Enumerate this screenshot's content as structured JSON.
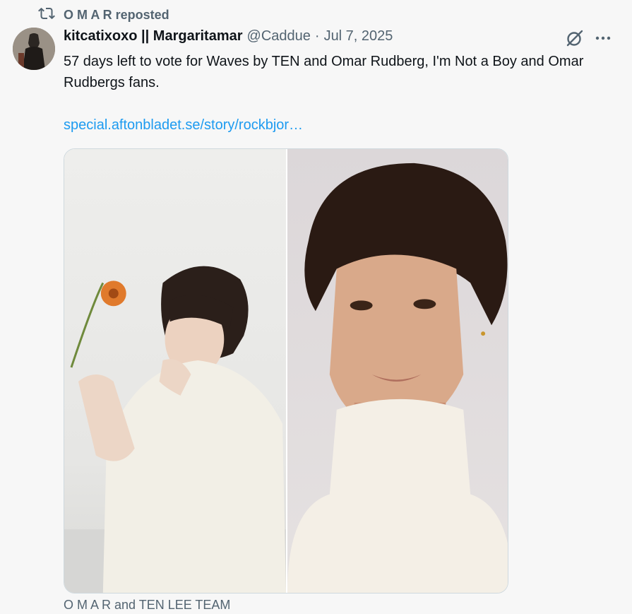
{
  "repost": {
    "label": "O M A R reposted",
    "icon": "repost-icon"
  },
  "author": {
    "display_name": "kitcatixoxo || Margaritamar",
    "handle": "@Caddue",
    "separator": "·",
    "date": "Jul 7, 2025",
    "avatar_icon": "avatar"
  },
  "tweet": {
    "text": "57 days left to vote for Waves by TEN and Omar Rudberg, I'm Not a Boy and Omar Rudbergs fans.",
    "link": "special.aftonbladet.se/story/rockbjor…"
  },
  "actions": {
    "grok_icon": "grok-icon",
    "more_icon": "more-icon"
  },
  "media": {
    "caption": "O M A R and TEN LEE TEAM",
    "photos": [
      "photo-left",
      "photo-right"
    ]
  },
  "colors": {
    "link": "#1d9bf0",
    "muted": "#536471",
    "text": "#0f1419",
    "background": "#f7f7f7"
  }
}
